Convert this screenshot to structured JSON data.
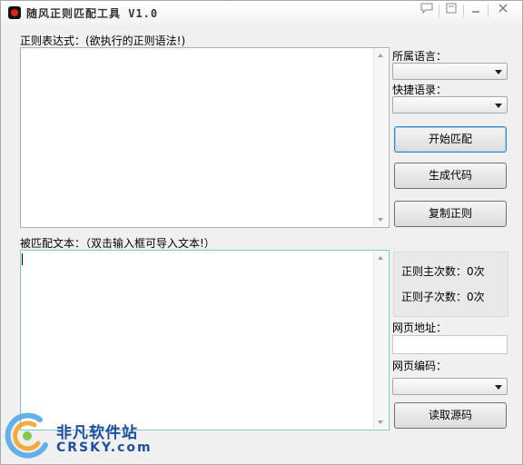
{
  "window": {
    "title": "随风正则匹配工具 V1.0",
    "title_buttons": [
      "chat-icon",
      "skin-icon",
      "minimize-icon",
      "close-icon"
    ]
  },
  "regex_section": {
    "label": "正则表达式：(欲执行的正则语法!)",
    "value": ""
  },
  "text_section": {
    "label": "被匹配文本：（双击输入框可导入文本!）",
    "value": ""
  },
  "sidebar": {
    "language_label": "所属语言：",
    "language_selected": "",
    "shortcut_label": "快捷语录：",
    "shortcut_selected": "",
    "start_match_label": "开始匹配",
    "generate_code_label": "生成代码",
    "copy_regex_label": "复制正则",
    "main_count_label": "正则主次数：",
    "main_count_value": "0次",
    "sub_count_label": "正则子次数：",
    "sub_count_value": "0次",
    "url_label": "网页地址：",
    "url_value": "",
    "encoding_label": "网页编码：",
    "encoding_selected": "",
    "read_source_label": "读取源码"
  },
  "watermark": {
    "text_cn": "非凡软件站",
    "text_en": "CRSKY.com"
  },
  "colors": {
    "window_bg": "#f0f0f0",
    "default_button_border": "#3c7fb1",
    "watermark_blue": "#1e4f9c"
  }
}
